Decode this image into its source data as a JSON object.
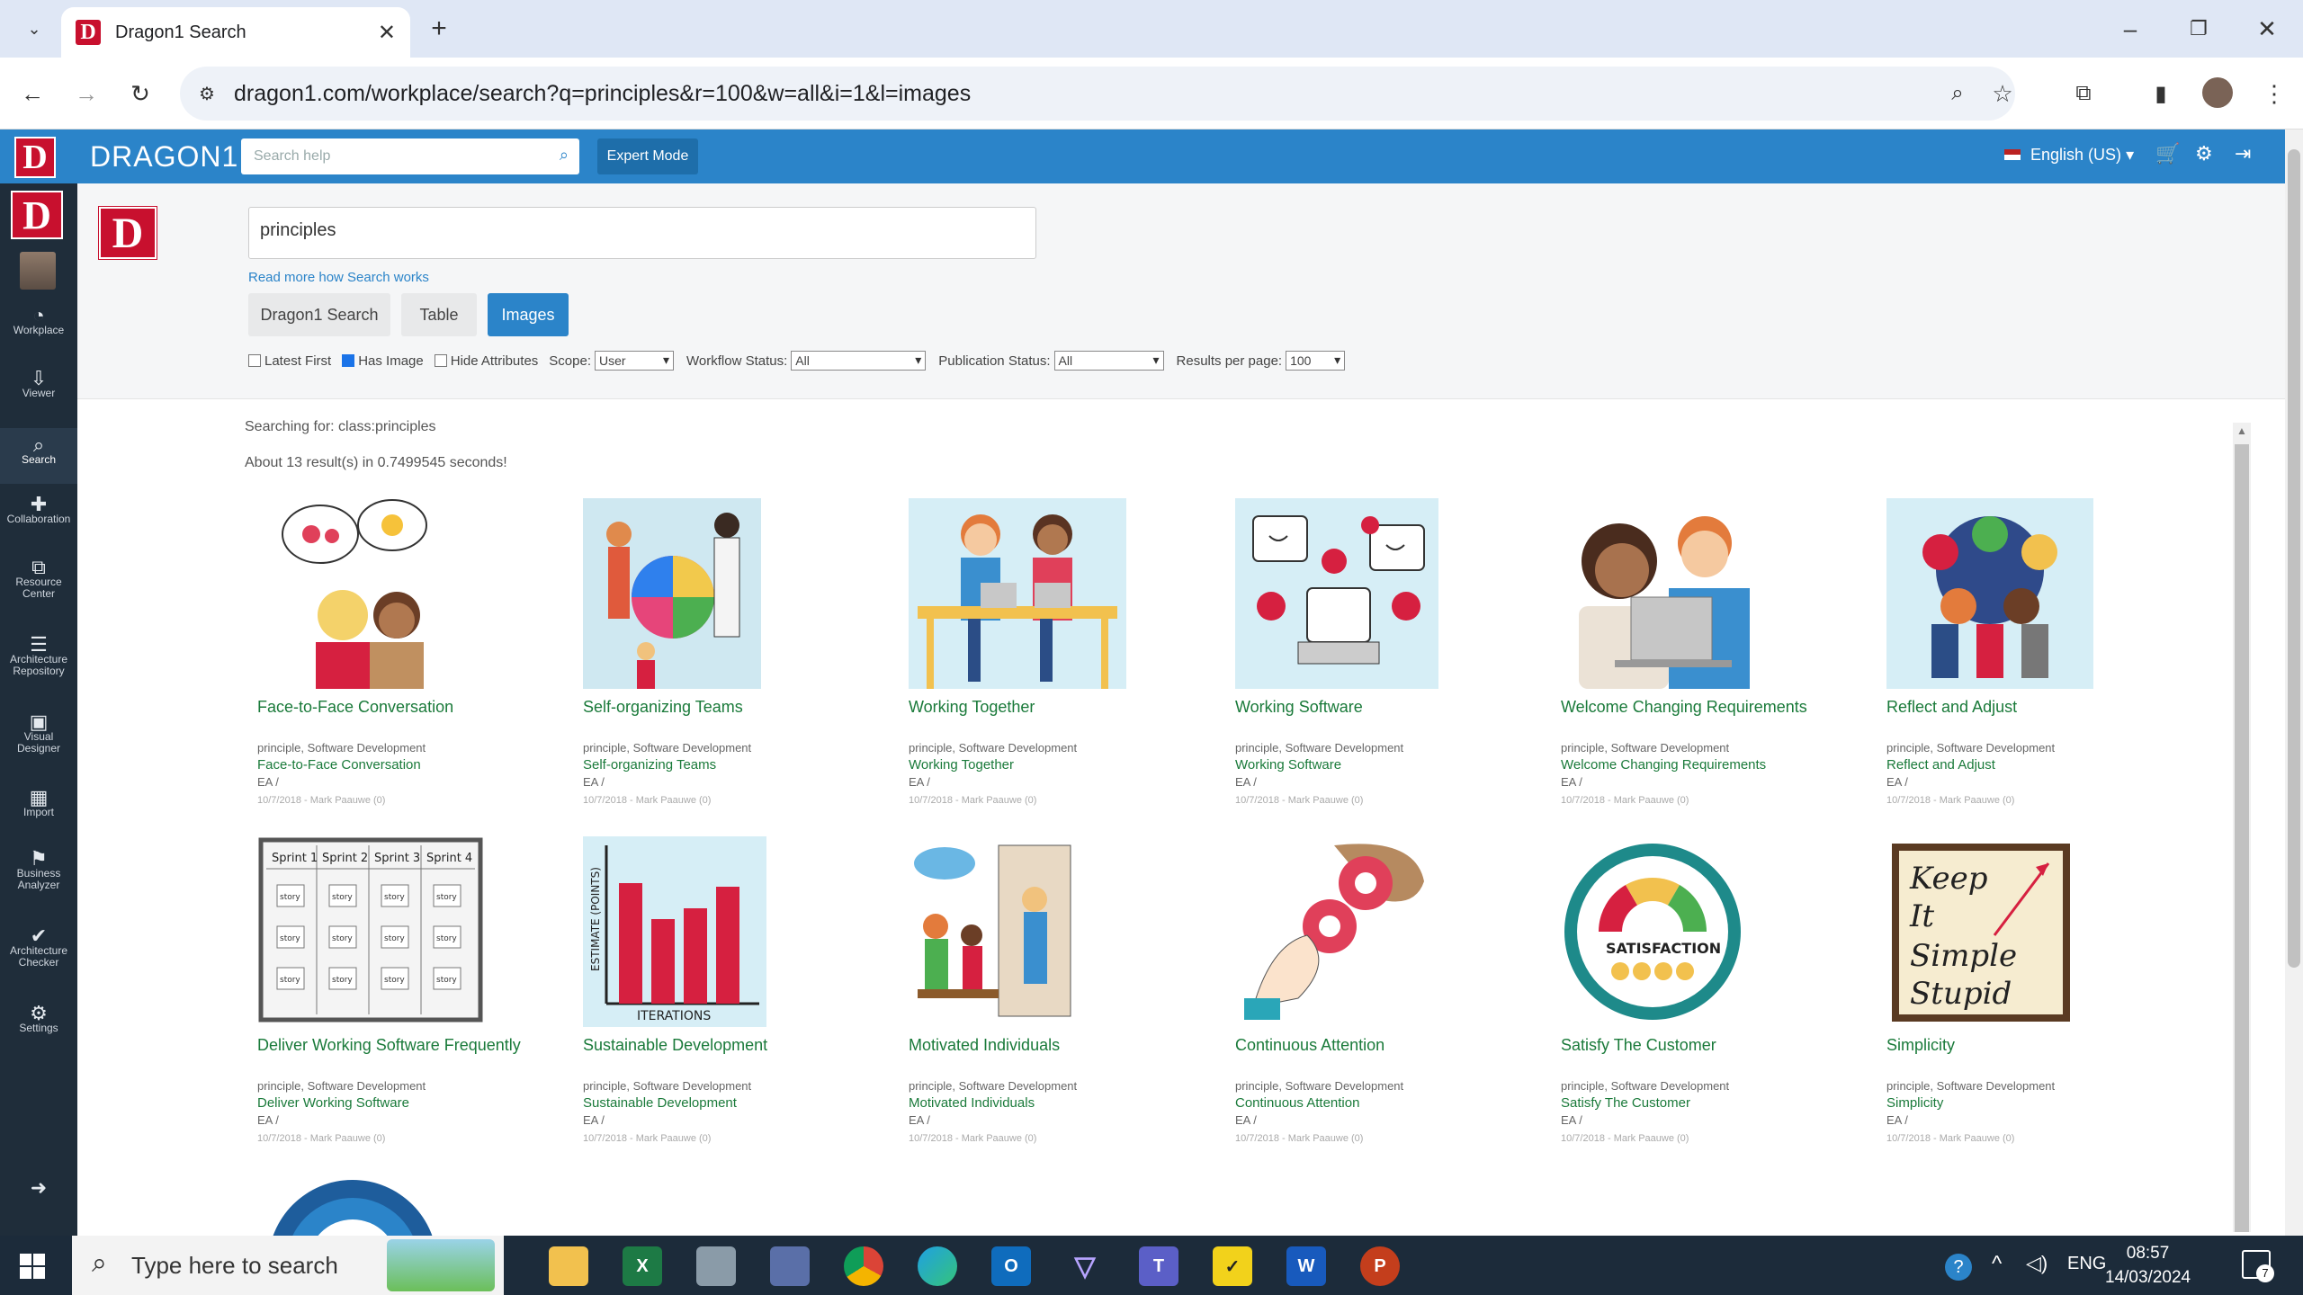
{
  "browser": {
    "tab_title": "Dragon1 Search",
    "url": "dragon1.com/workplace/search?q=principles&r=100&w=all&i=1&l=images"
  },
  "header": {
    "app_name": "DRAGON1",
    "search_placeholder": "Search help",
    "expert_mode": "Expert Mode",
    "language": "English (US)"
  },
  "sidebar": {
    "items": [
      {
        "label": "Workplace",
        "icon": "dashboard-icon"
      },
      {
        "label": "Viewer",
        "icon": "viewer-icon"
      },
      {
        "label": "Search",
        "icon": "search-icon"
      },
      {
        "label": "Collaboration",
        "icon": "collaboration-icon"
      },
      {
        "label": "Resource Center",
        "icon": "resource-icon"
      },
      {
        "label": "Architecture Repository",
        "icon": "database-icon"
      },
      {
        "label": "Visual Designer",
        "icon": "image-icon"
      },
      {
        "label": "Import",
        "icon": "table-icon"
      },
      {
        "label": "Business Analyzer",
        "icon": "flag-icon"
      },
      {
        "label": "Architecture Checker",
        "icon": "check-icon"
      },
      {
        "label": "Settings",
        "icon": "gear-icon"
      }
    ]
  },
  "search": {
    "query": "principles",
    "read_more": "Read more how Search works",
    "tabs": [
      "Dragon1 Search",
      "Table",
      "Images"
    ],
    "active_tab": "Images",
    "latest_first": "Latest First",
    "has_image": "Has Image",
    "hide_attributes": "Hide Attributes",
    "scope_label": "Scope:",
    "scope_value": "User",
    "workflow_label": "Workflow Status:",
    "workflow_value": "All",
    "publication_label": "Publication Status:",
    "publication_value": "All",
    "rpp_label": "Results per page:",
    "rpp_value": "100",
    "searching_for": "Searching for: class:principles",
    "results_text": "About 13 result(s) in 0.7499545 seconds!"
  },
  "results": [
    {
      "title": "Face-to-Face Conversation",
      "meta": "principle, Software Development",
      "link": "Face-to-Face Conversation",
      "ea": "EA /",
      "date": "10/7/2018 - Mark Paauwe (0)"
    },
    {
      "title": "Self-organizing Teams",
      "meta": "principle, Software Development",
      "link": "Self-organizing Teams",
      "ea": "EA /",
      "date": "10/7/2018 - Mark Paauwe (0)"
    },
    {
      "title": "Working Together",
      "meta": "principle, Software Development",
      "link": "Working Together",
      "ea": "EA /",
      "date": "10/7/2018 - Mark Paauwe (0)"
    },
    {
      "title": "Working Software",
      "meta": "principle, Software Development",
      "link": "Working Software",
      "ea": "EA /",
      "date": "10/7/2018 - Mark Paauwe (0)"
    },
    {
      "title": "Welcome Changing Requirements",
      "meta": "principle, Software Development",
      "link": "Welcome Changing Requirements",
      "ea": "EA /",
      "date": "10/7/2018 - Mark Paauwe (0)"
    },
    {
      "title": "Reflect and Adjust",
      "meta": "principle, Software Development",
      "link": "Reflect and Adjust",
      "ea": "EA /",
      "date": "10/7/2018 - Mark Paauwe (0)"
    },
    {
      "title": "Deliver Working Software Frequently",
      "meta": "principle, Software Development",
      "link": "Deliver Working Software",
      "ea": "EA /",
      "date": "10/7/2018 - Mark Paauwe (0)"
    },
    {
      "title": "Sustainable Development",
      "meta": "principle, Software Development",
      "link": "Sustainable Development",
      "ea": "EA /",
      "date": "10/7/2018 - Mark Paauwe (0)"
    },
    {
      "title": "Motivated Individuals",
      "meta": "principle, Software Development",
      "link": "Motivated Individuals",
      "ea": "EA /",
      "date": "10/7/2018 - Mark Paauwe (0)"
    },
    {
      "title": "Continuous Attention",
      "meta": "principle, Software Development",
      "link": "Continuous Attention",
      "ea": "EA /",
      "date": "10/7/2018 - Mark Paauwe (0)"
    },
    {
      "title": "Satisfy The Customer",
      "meta": "principle, Software Development",
      "link": "Satisfy The Customer",
      "ea": "EA /",
      "date": "10/7/2018 - Mark Paauwe (0)"
    },
    {
      "title": "Simplicity",
      "meta": "principle, Software Development",
      "link": "Simplicity",
      "ea": "EA /",
      "date": "10/7/2018 - Mark Paauwe (0)"
    }
  ],
  "illustrations": {
    "sprints": [
      "Sprint 1",
      "Sprint 2",
      "Sprint 3",
      "Sprint 4"
    ],
    "story": "story",
    "estimate": "ESTIMATE (POINTS)",
    "iterations": "ITERATIONS",
    "satisfaction": "SATISFACTION",
    "kiss": [
      "Keep",
      "It",
      "Simple",
      "Stupid"
    ]
  },
  "taskbar": {
    "search_placeholder": "Type here to search",
    "lang": "ENG",
    "time": "08:57",
    "date": "14/03/2024",
    "notif_count": "7"
  }
}
